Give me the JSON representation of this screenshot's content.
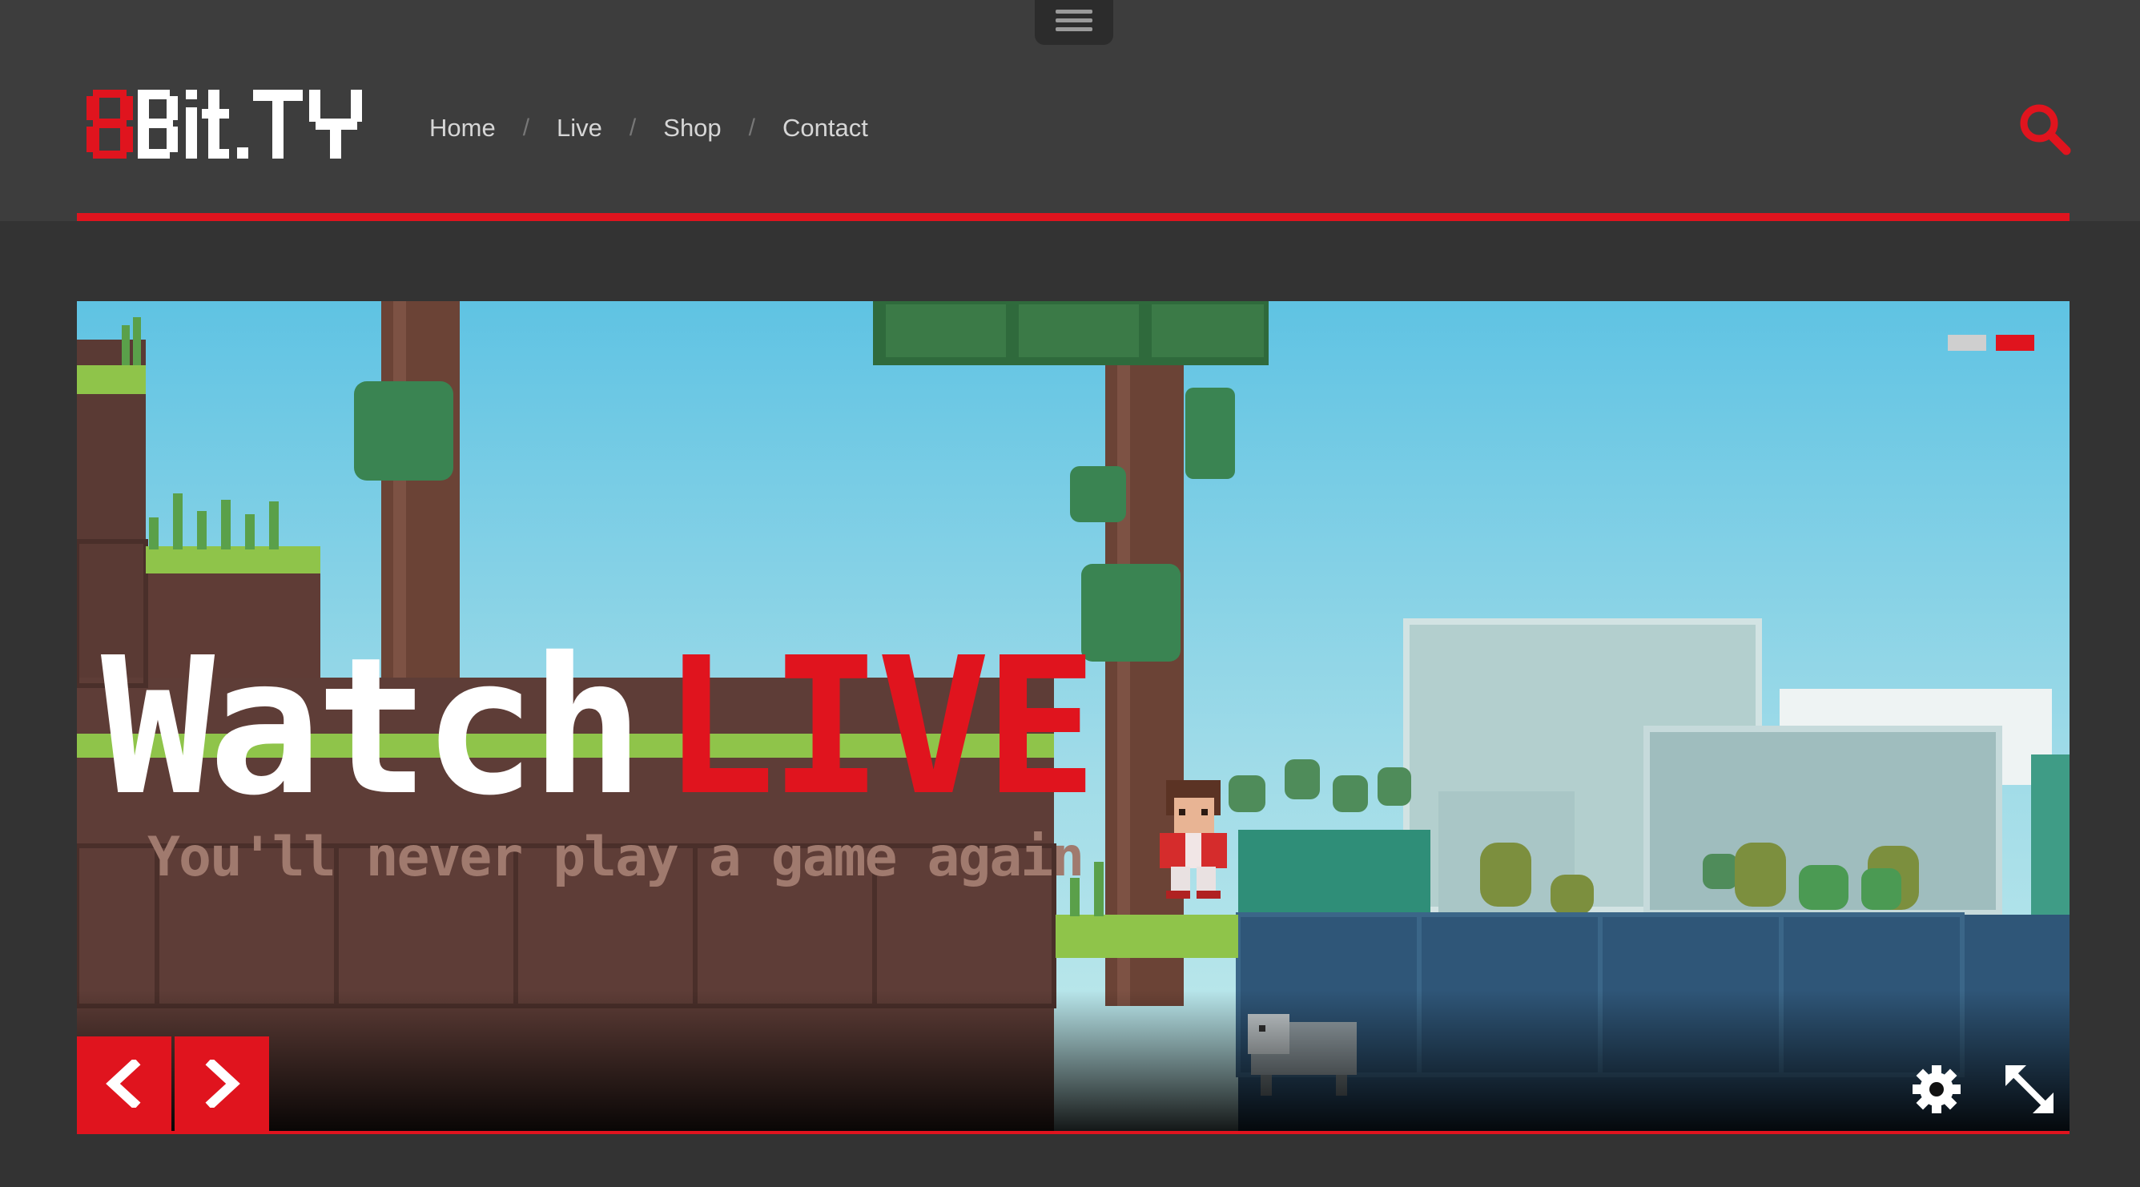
{
  "site": {
    "logo_text": "8Bit.TY"
  },
  "nav": {
    "items": [
      {
        "label": "Home"
      },
      {
        "label": "Live"
      },
      {
        "label": "Shop"
      },
      {
        "label": "Contact"
      }
    ],
    "separator": "/"
  },
  "hero": {
    "headline_white": "Watch",
    "headline_red": "LIVE",
    "subline": "You'll never play a game again",
    "slides_total": 2,
    "active_slide": 2
  },
  "colors": {
    "accent": "#e0141e",
    "header_bg": "#3d3d3d",
    "page_bg": "#333333",
    "dot_inactive": "#cfcfcf"
  },
  "icons": {
    "menu": "hamburger-icon",
    "search": "search-icon",
    "prev": "chevron-left-icon",
    "next": "chevron-right-icon",
    "settings": "gear-icon",
    "fullscreen": "expand-icon"
  }
}
